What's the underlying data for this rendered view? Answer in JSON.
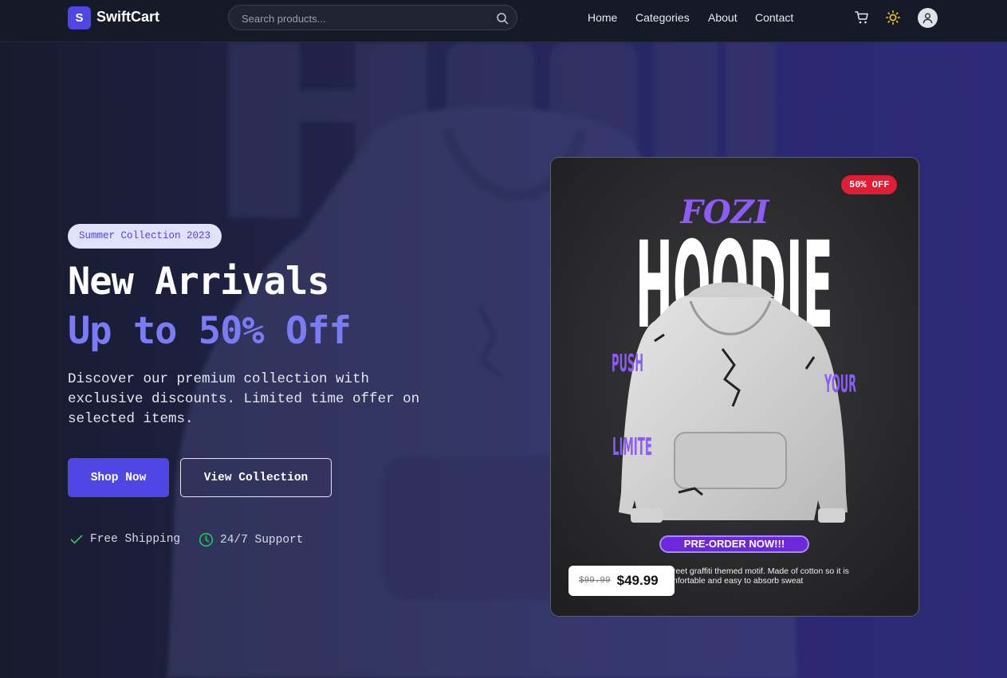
{
  "header": {
    "logo_letter": "S",
    "brand": "SwiftCart",
    "search_placeholder": "Search products...",
    "nav": [
      "Home",
      "Categories",
      "About",
      "Contact"
    ]
  },
  "hero": {
    "badge": "Summer Collection 2023",
    "title": "New Arrivals",
    "subtitle": "Up to 50% Off",
    "description": "Discover our premium collection with exclusive discounts. Limited time offer on selected items.",
    "primary_cta": "Shop Now",
    "secondary_cta": "View Collection",
    "features": [
      "Free Shipping",
      "24/7 Support"
    ]
  },
  "product_card": {
    "discount_badge": "50% OFF",
    "art_title": "HOODIE",
    "art_script": "FOZI",
    "art_words": [
      "PUSH",
      "YOUR",
      "LIMITE"
    ],
    "preorder": "PRE-ORDER NOW!!!",
    "caption": "treet graffiti themed motif. Made of cotton so it is mfortable and easy to absorb sweat",
    "old_price": "$99.99",
    "new_price": "$49.99"
  },
  "colors": {
    "accent": "#4f46e5",
    "accent_light": "#7b7cf5",
    "sale_red": "#e11d36",
    "success_green": "#22c55e",
    "sun_yellow": "#facc15"
  }
}
